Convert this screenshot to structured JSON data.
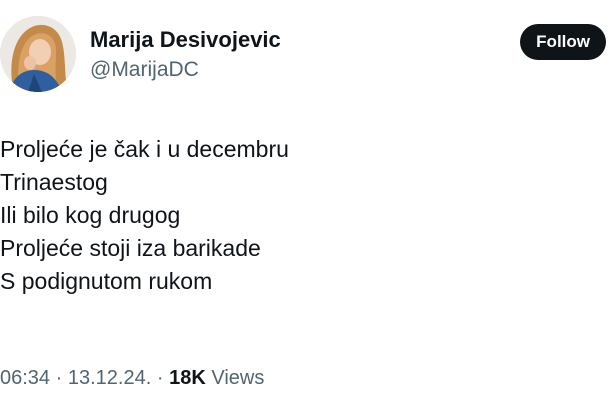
{
  "author": {
    "display_name": "Marija Desivojevic",
    "handle": "@MarijaDC",
    "avatar_icon": "profile-photo"
  },
  "follow_button": {
    "label": "Follow"
  },
  "tweet": {
    "lines": [
      "Proljeće je čak i u decembru",
      "Trinaestog",
      "Ili bilo kog drugog",
      "Proljeće stoji iza barikade",
      "S podignutom rukom"
    ]
  },
  "meta": {
    "time": "06:34",
    "separator": "·",
    "date": "13.12.24.",
    "views_count": "18K",
    "views_label": "Views"
  },
  "colors": {
    "text_primary": "#0f1419",
    "text_secondary": "#536471",
    "button_bg": "#0f1419",
    "button_text": "#ffffff"
  }
}
